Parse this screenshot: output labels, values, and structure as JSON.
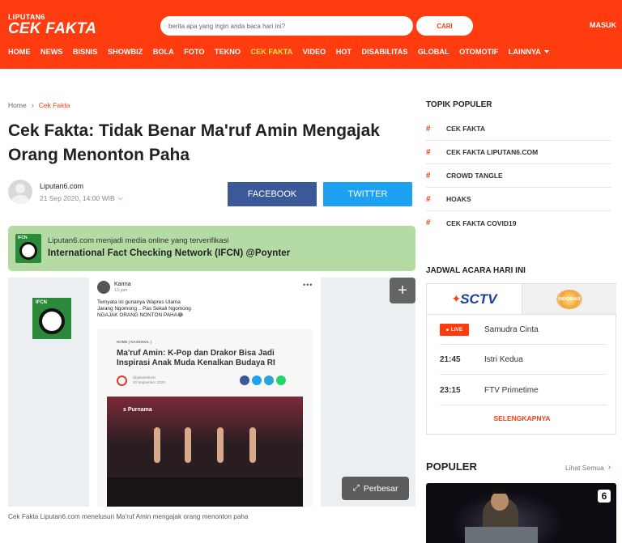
{
  "brand": {
    "small": "LIPUTAN6",
    "big": "CEK FAKTA"
  },
  "search": {
    "placeholder": "berita apa yang ingin anda baca hari ini?",
    "button": "CARI"
  },
  "login": "MASUK",
  "nav": [
    "HOME",
    "NEWS",
    "BISNIS",
    "SHOWBIZ",
    "BOLA",
    "FOTO",
    "TEKNO",
    "CEK FAKTA",
    "VIDEO",
    "HOT",
    "DISABILITAS",
    "GLOBAL",
    "OTOMOTIF",
    "LAINNYA"
  ],
  "nav_active": "CEK FAKTA",
  "colors": {
    "brand": "#ff3c0f",
    "active_nav": "#ffe34d",
    "facebook": "#3b5998",
    "twitter": "#1da1f2",
    "ifcn_bg": "#b3dba3"
  },
  "breadcrumb": {
    "home": "Home",
    "current": "Cek Fakta"
  },
  "article": {
    "title": "Cek Fakta: Tidak Benar Ma'ruf Amin Mengajak Orang Menonton Paha",
    "author": "Liputan6.com",
    "date": "21 Sep 2020, 14:00 WIB",
    "share_facebook": "FACEBOOK",
    "share_twitter": "TWITTER",
    "ifcn_line1": "Liputan6.com menjadi media online yang terverifikasi",
    "ifcn_line2": "International Fact Checking Network (IFCN) @Poynter",
    "caption": "Cek Fakta Liputan6.com menelusuri Ma'ruf Amin mengajak orang menonton paha",
    "enlarge": "Perbesar"
  },
  "embedded_post": {
    "name": "Karma",
    "time": "13 jam",
    "text_lines": [
      "Ternyata ini gunanya Wapres Ulama",
      "Jarang Ngomong .. Pas Sekali Ngomong",
      "NGAJAK ORANG NONTON PAHA😂"
    ],
    "card_category": "HOME | NASIONAL |",
    "card_title": "Ma'ruf Amin: K-Pop dan Drakor Bisa Jadi Inspirasi Anak Muda Kenalkan Budaya RI",
    "card_source": "@jalantelevisi",
    "card_date": "20 September 2020",
    "photo_label": "s Purnama"
  },
  "sidebar": {
    "topik_title": "TOPIK POPULER",
    "topik": [
      "CEK FAKTA",
      "CEK FAKTA LIPUTAN6.COM",
      "CROWD TANGLE",
      "HOAKS",
      "CEK FAKTA COVID19"
    ],
    "jadwal_title": "JADWAL ACARA HARI INI",
    "channels": [
      "SCTV",
      "INDOSIAR"
    ],
    "schedule": [
      {
        "time": "LIVE",
        "show": "Samudra Cinta"
      },
      {
        "time": "21:45",
        "show": "Istri Kedua"
      },
      {
        "time": "23:15",
        "show": "FTV Primetime"
      }
    ],
    "more": "SELENGKAPNYA",
    "populer_title": "POPULER",
    "lihat_semua": "Lihat Semua",
    "badge": "6"
  }
}
